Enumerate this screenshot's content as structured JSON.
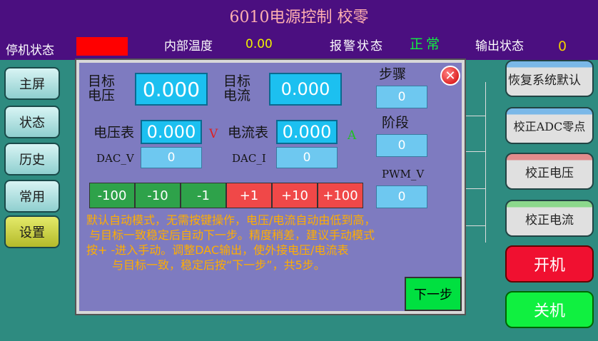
{
  "header": {
    "title": "6010电源控制 校零",
    "shutdown_label": "停机状态",
    "shutdown_color": "#FF0000",
    "temp_label": "内部温度",
    "temp_value": "0.00",
    "alarm_label": "报警状态",
    "alarm_value": "正常",
    "output_label": "输出状态",
    "output_value": "0"
  },
  "nav": {
    "items": [
      "主屏",
      "状态",
      "历史",
      "常用",
      "设置"
    ],
    "active": "设置"
  },
  "right": {
    "restore_default": "恢复系统默认",
    "calib_adc_zero": "校正ADC零点",
    "calib_voltage": "校正电压",
    "calib_current": "校正电流",
    "power_on": "开机",
    "power_off": "关机"
  },
  "dialog": {
    "target_voltage_label": "目标\n电压",
    "target_voltage_value": "0.000",
    "target_current_label": "目标\n电流",
    "target_current_value": "0.000",
    "voltmeter_label": "电压表",
    "voltmeter_value": "0.000",
    "voltmeter_unit": "V",
    "ammeter_label": "电流表",
    "ammeter_value": "0.000",
    "ammeter_unit": "A",
    "dac_v_label": "DAC_V",
    "dac_v_value": "0",
    "dac_i_label": "DAC_I",
    "dac_i_value": "0",
    "step_label": "步骤",
    "step_value": "0",
    "stage_label": "阶段",
    "stage_value": "0",
    "pwm_label": "PWM_V",
    "pwm_value": "0",
    "adjust_buttons": [
      "-100",
      "-10",
      "-1",
      "+1",
      "+10",
      "+100"
    ],
    "description": [
      "默认自动模式，无需按键操作，电压/电流自动由低到高，",
      "与目标一致稳定后自动下一步。精度稍差，建议手动模式",
      "按+ -进入手动。调整DAC输出，使外接电压/电流表",
      "与目标一致，稳定后按“下一步”，共5步。"
    ],
    "next_label": "下一步",
    "close_glyph": "✕"
  }
}
